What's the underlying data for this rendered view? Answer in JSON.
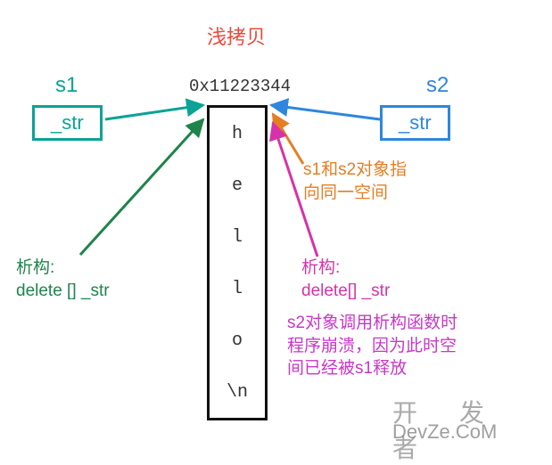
{
  "title": "浅拷贝",
  "s1": {
    "name": "s1",
    "member": "_str"
  },
  "s2": {
    "name": "s2",
    "member": "_str"
  },
  "address": "0x11223344",
  "memory": {
    "cells": [
      "h",
      "e",
      "l",
      "l",
      "o",
      "\\n"
    ]
  },
  "annotations": {
    "destructor_s1": {
      "line1": "析构:",
      "line2": "delete [] _str"
    },
    "same_space": {
      "line1": "s1和s2对象指",
      "line2": "向同一空间"
    },
    "destructor_s2": {
      "line1": "析构:",
      "line2": "delete[] _str"
    },
    "crash": {
      "line1": "s2对象调用析构函数时",
      "line2": "程序崩溃，因为此时空",
      "line3": "间已经被s1释放"
    }
  },
  "watermark": {
    "line1": "开 发 者",
    "line2": "DevZe.CoM"
  },
  "colors": {
    "teal": "#0aa396",
    "blue": "#2e86de",
    "green": "#1e8449",
    "orange": "#e67e22",
    "magenta": "#d633a8",
    "purple": "#c837c8",
    "red": "#e74c3c"
  }
}
